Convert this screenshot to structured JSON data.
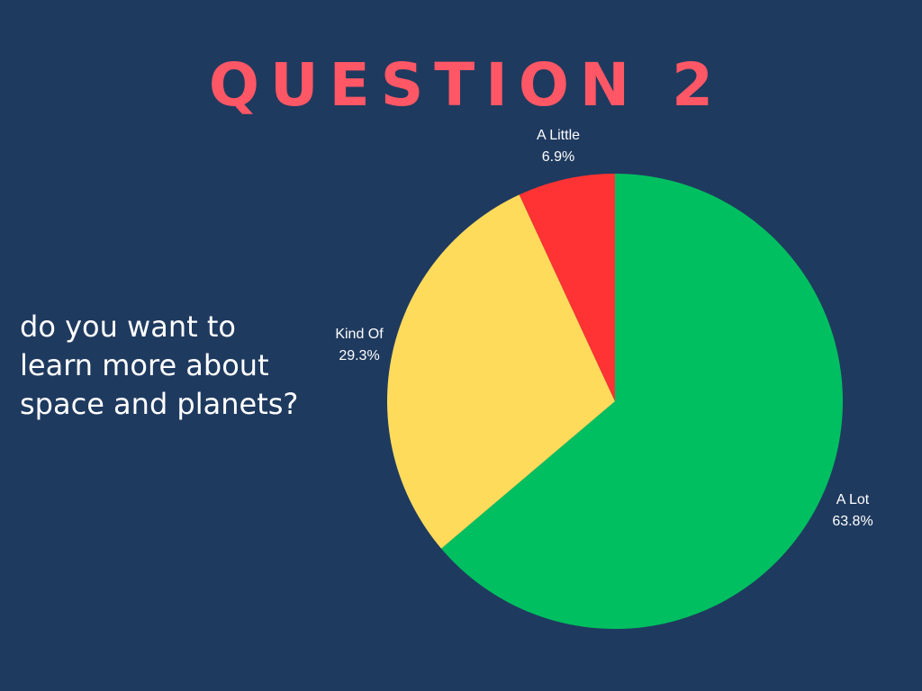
{
  "slide": {
    "title": "QUESTION 2",
    "question_lines": [
      "do you want to",
      "learn more about",
      "space and planets?"
    ],
    "background_color": "#1f3a5f",
    "title_color": "#ff5765"
  },
  "chart_data": {
    "type": "pie",
    "title": "",
    "slices": [
      {
        "label": "A Lot",
        "value": 63.8,
        "value_label": "63.8%",
        "color": "#00bf60"
      },
      {
        "label": "Kind Of",
        "value": 29.3,
        "value_label": "29.3%",
        "color": "#ffdb5c"
      },
      {
        "label": "A Little",
        "value": 6.9,
        "value_label": "6.9%",
        "color": "#ff3333"
      }
    ],
    "start_direction": "top",
    "direction": "clockwise",
    "labels_outside": true
  }
}
